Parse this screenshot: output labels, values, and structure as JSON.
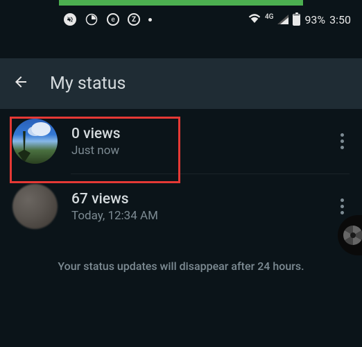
{
  "statusbar": {
    "network_label": "4G",
    "battery_pct": "93%",
    "time": "3:50"
  },
  "header": {
    "title": "My status"
  },
  "items": [
    {
      "views": "0 views",
      "time": "Just now"
    },
    {
      "views": "67 views",
      "time": "Today, 12:34 AM"
    }
  ],
  "footer": "Your status updates will disappear after 24 hours."
}
